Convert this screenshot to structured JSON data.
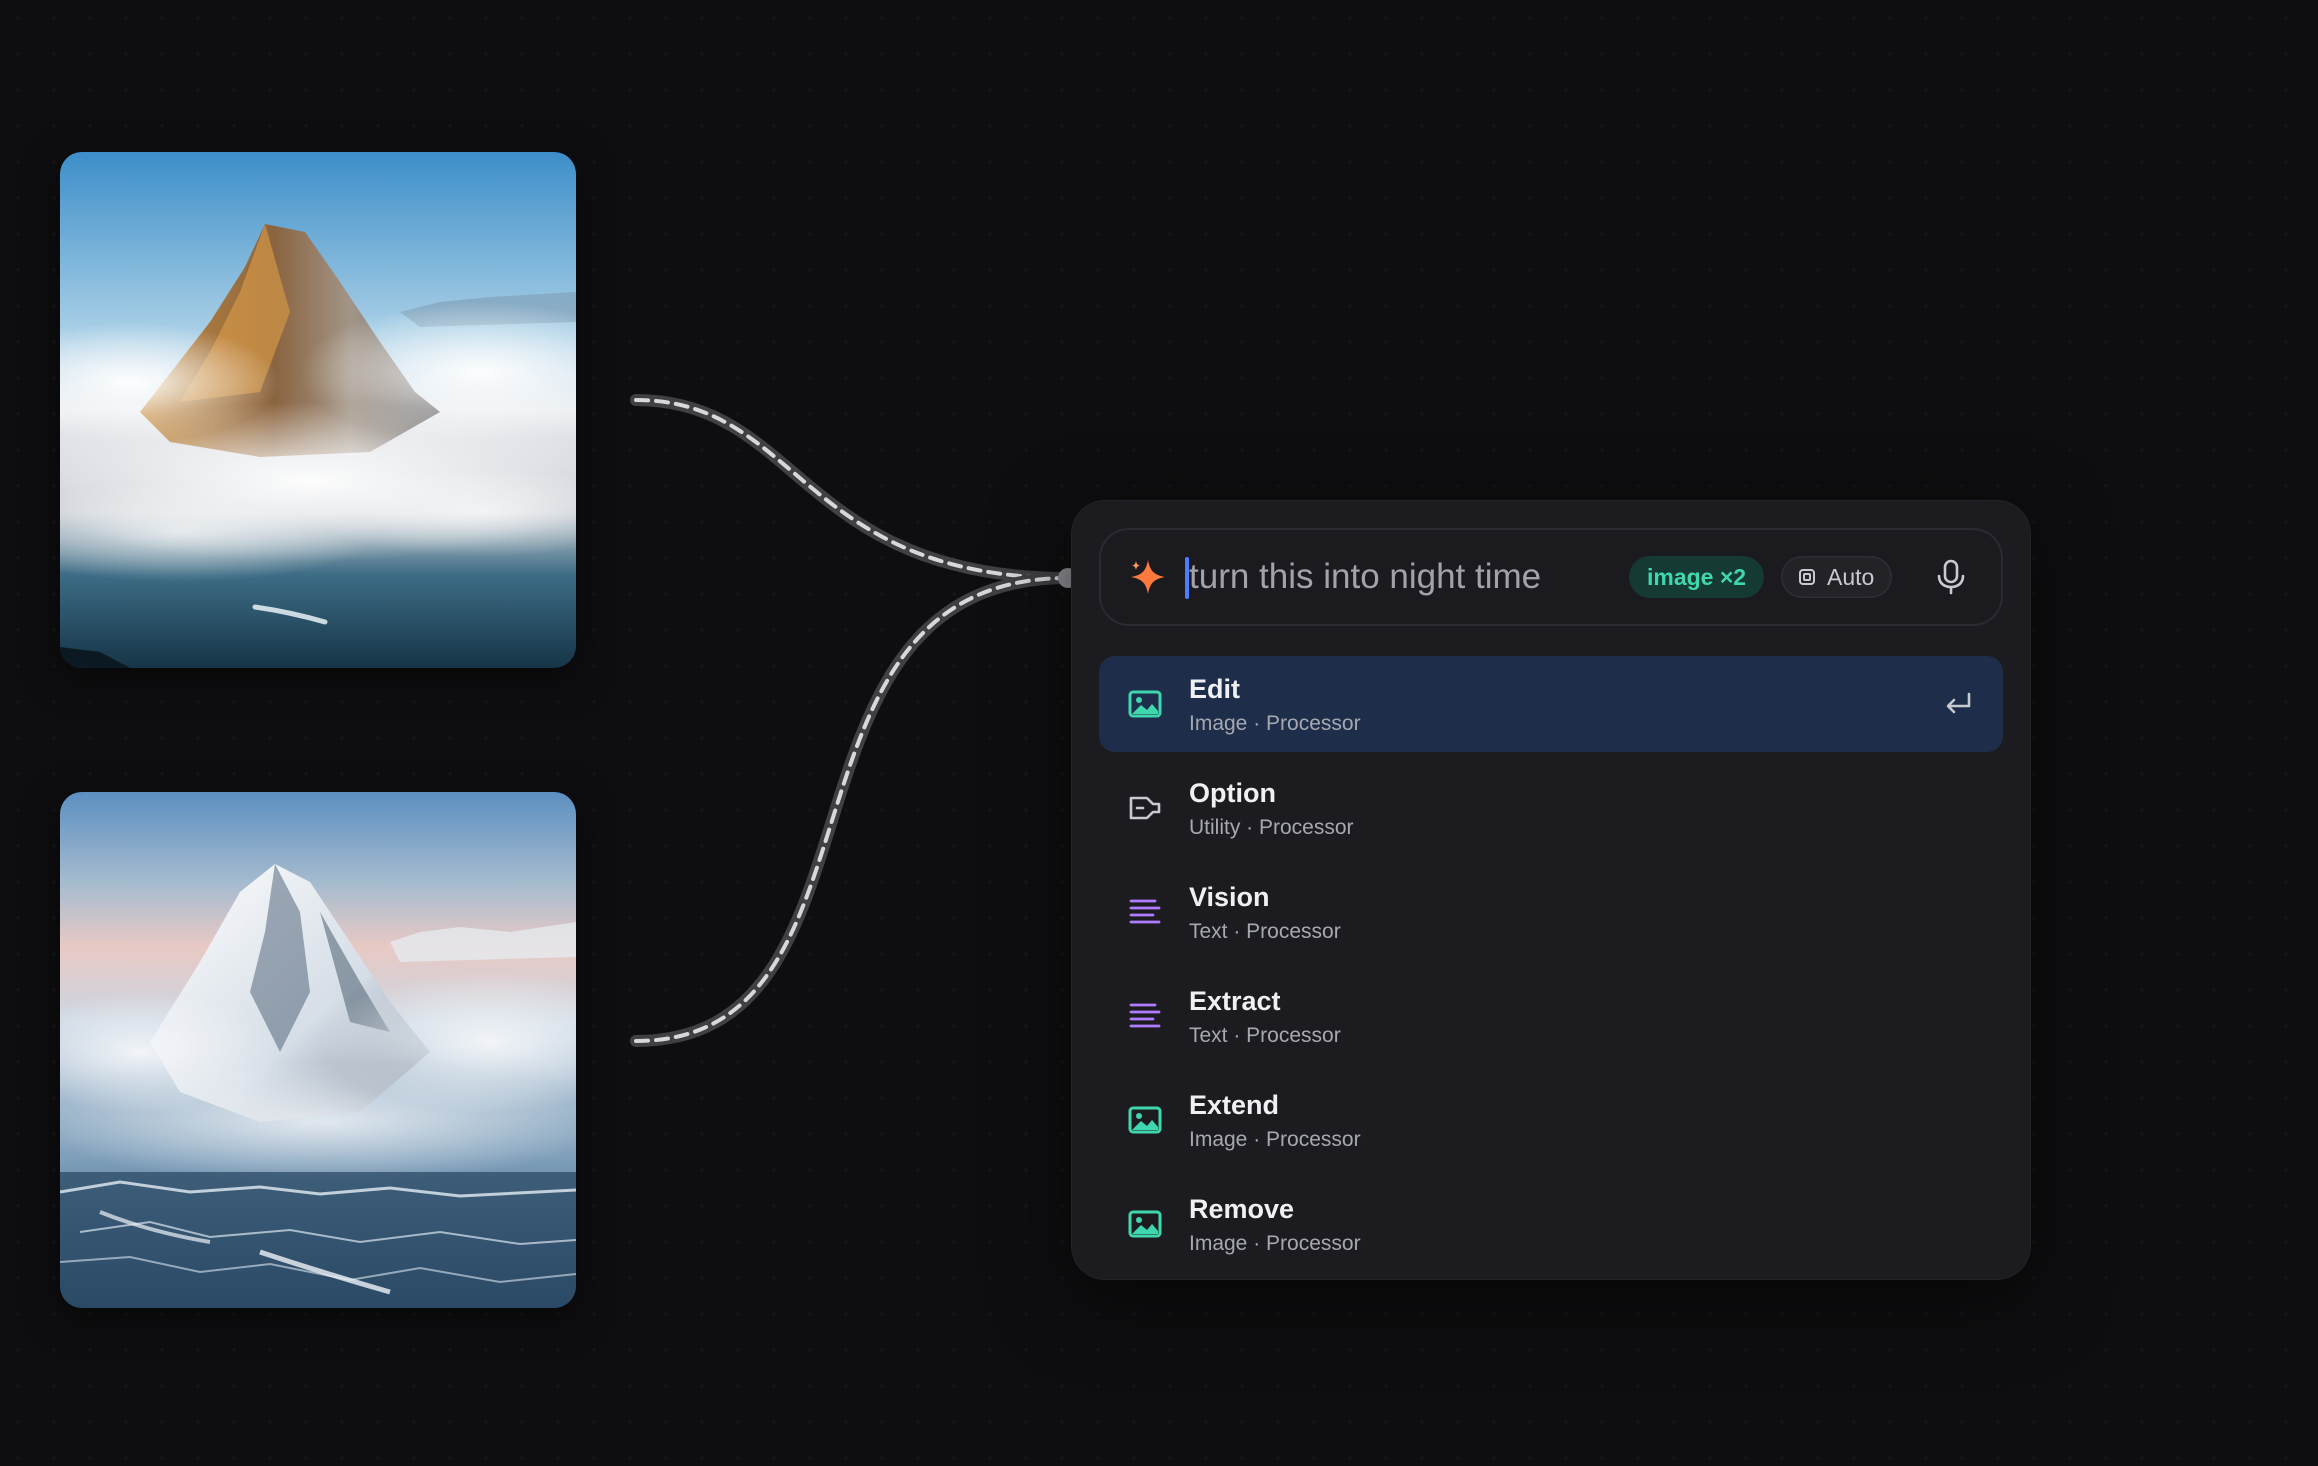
{
  "images": [
    {
      "name": "mountain-golden-peak-image"
    },
    {
      "name": "mountain-snow-peak-image"
    }
  ],
  "prompt": {
    "text": "turn this into night time",
    "icon": "sparkle-icon",
    "chips": {
      "image_count": "image ×2",
      "model": "Auto"
    },
    "mic_icon": "microphone-icon"
  },
  "menu": {
    "items": [
      {
        "title": "Edit",
        "subtitle": "Image · Processor",
        "icon": "image-icon",
        "selected": true
      },
      {
        "title": "Option",
        "subtitle": "Utility · Processor",
        "icon": "option-icon",
        "selected": false
      },
      {
        "title": "Vision",
        "subtitle": "Text · Processor",
        "icon": "text-lines-icon",
        "selected": false
      },
      {
        "title": "Extract",
        "subtitle": "Text · Processor",
        "icon": "text-lines-icon",
        "selected": false
      },
      {
        "title": "Extend",
        "subtitle": "Image · Processor",
        "icon": "image-icon",
        "selected": false
      },
      {
        "title": "Remove",
        "subtitle": "Image · Processor",
        "icon": "image-icon",
        "selected": false
      }
    ]
  },
  "colors": {
    "background": "#0e0e10",
    "panel": "#1c1c20",
    "selected_row": "#1d2d4a",
    "image_icon": "#3fd7ae",
    "text_icon": "#b07cff",
    "sparkle": "#ff7a3c"
  }
}
